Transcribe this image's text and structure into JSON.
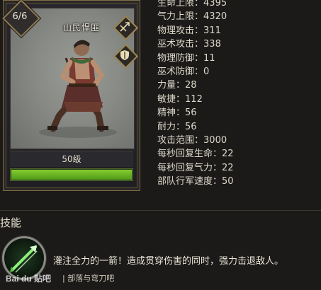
{
  "unit": {
    "name": "山民悍匪",
    "count": "6/6",
    "level": "50级",
    "health_fraction": 1.0
  },
  "stats": [
    {
      "label": "生命上限",
      "value": "4395"
    },
    {
      "label": "气力上限",
      "value": "4320"
    },
    {
      "label": "物理攻击",
      "value": "311"
    },
    {
      "label": "巫术攻击",
      "value": "338"
    },
    {
      "label": "物理防御",
      "value": "11"
    },
    {
      "label": "巫术防御",
      "value": "0"
    },
    {
      "label": "力量",
      "value": "28"
    },
    {
      "label": "敏捷",
      "value": "112"
    },
    {
      "label": "精神",
      "value": "56"
    },
    {
      "label": "耐力",
      "value": "56"
    },
    {
      "label": "攻击范围",
      "value": "3000"
    },
    {
      "label": "每秒回复生命",
      "value": "22"
    },
    {
      "label": "每秒回复气力",
      "value": "22"
    },
    {
      "label": "部队行军速度",
      "value": "50"
    }
  ],
  "skills": {
    "title": "技能",
    "items": [
      {
        "icon": "arrow-skill-icon",
        "description": "灌注全力的一箭！造成贯穿伤害的同时，强力击退敌人。"
      }
    ]
  },
  "footer": {
    "caption": "| 部落与弯刀吧",
    "watermark": "Bai du 贴吧"
  },
  "colors": {
    "accent_gold": "#a08954",
    "health_green": "#6fb828"
  }
}
